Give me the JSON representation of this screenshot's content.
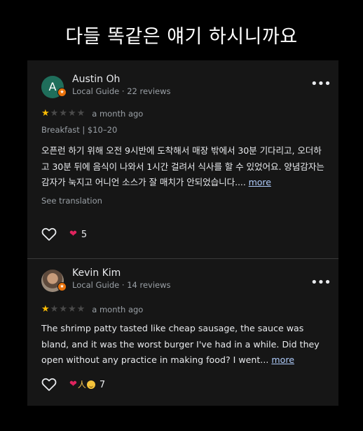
{
  "headline": "다들 똑같은 얘기 하시니까요",
  "reviews": [
    {
      "avatar_letter": "A",
      "name": "Austin Oh",
      "meta": "Local Guide · 22 reviews",
      "rating": 1,
      "rating_max": 5,
      "time": "a month ago",
      "tags": "Breakfast  |  $10–20",
      "body": "오픈런 하기 위해 오전 9시반에 도착해서 매장 밖에서 30분 기다리고, 오더하고 30분 뒤에 음식이 나와서 1시간 걸려서 식사를 할 수 있었어요. 양념감자는 감자가 눅지고 어니언 소스가  잘 매치가 안되었습니다....",
      "more_label": "more",
      "see_translation": "See translation",
      "reaction_count": "5",
      "icons": [
        "heart-outline-icon",
        "heart-reaction-icon",
        "more-vert-icon",
        "local-guide-badge-icon"
      ]
    },
    {
      "name": "Kevin Kim",
      "meta": "Local Guide · 14 reviews",
      "rating": 1,
      "rating_max": 5,
      "time": "a month ago",
      "body": "The shrimp patty tasted like cheap sausage, the sauce was bland, and it was the worst burger I've had in a while. Did they open without any practice in making food? I went...",
      "more_label": "more",
      "reaction_count": "7",
      "icons": [
        "heart-outline-icon",
        "heart-reaction-icon",
        "pray-reaction-icon",
        "smile-reaction-icon",
        "more-vert-icon",
        "local-guide-badge-icon"
      ]
    }
  ],
  "colors": {
    "background": "#000000",
    "panel": "#161616",
    "star_on": "#fbbc04",
    "star_off": "#4a4a4a",
    "link": "#aecbfa",
    "guide_badge": "#e8710a",
    "heart": "#e0245e",
    "avatar": "#1f6e5b"
  }
}
